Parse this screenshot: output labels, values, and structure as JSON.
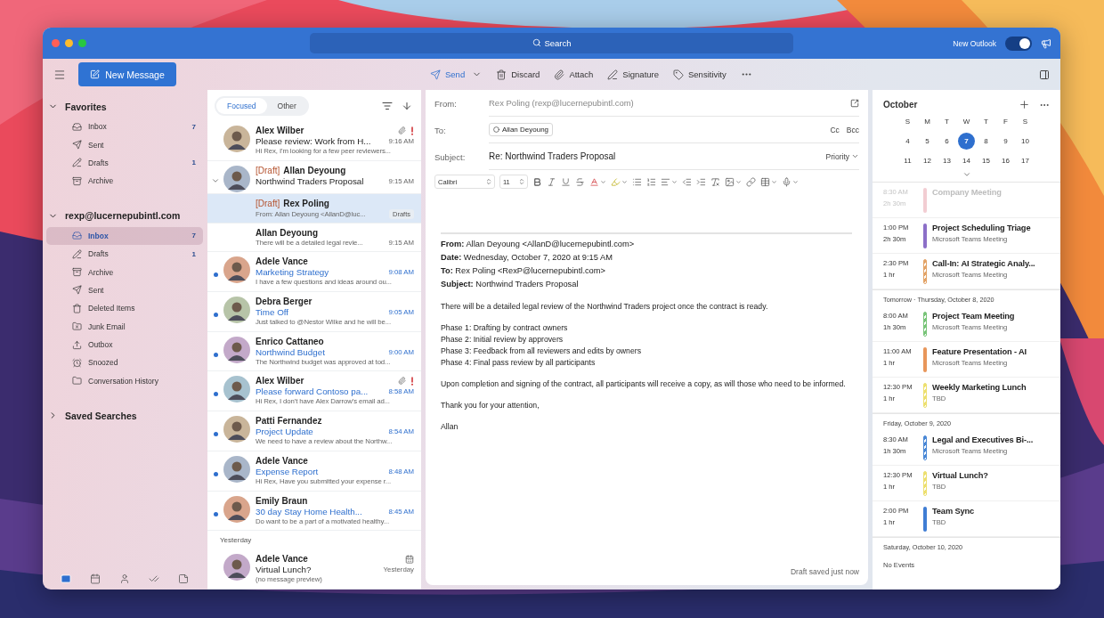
{
  "window": {
    "search": {
      "placeholder": "Search"
    },
    "new_outlook": {
      "label": "New Outlook",
      "on": true
    }
  },
  "toolbar": {
    "new_message": "New Message",
    "actions": [
      {
        "kind": "send",
        "label": "Send"
      },
      {
        "kind": "discard",
        "label": "Discard"
      },
      {
        "kind": "attach",
        "label": "Attach"
      },
      {
        "kind": "signature",
        "label": "Signature"
      },
      {
        "kind": "sensitivity",
        "label": "Sensitivity"
      }
    ]
  },
  "sidebar": {
    "sections": [
      {
        "label": "Favorites",
        "expanded": true,
        "items": [
          {
            "kind": "inbox",
            "label": "Inbox",
            "count": "7",
            "selected": false
          },
          {
            "kind": "sent",
            "label": "Sent",
            "selected": false
          },
          {
            "kind": "drafts",
            "label": "Drafts",
            "count": "1",
            "selected": false
          },
          {
            "kind": "archive",
            "label": "Archive",
            "selected": false
          }
        ]
      },
      {
        "label": "rexp@lucernepubintl.com",
        "expanded": true,
        "items": [
          {
            "kind": "inbox",
            "label": "Inbox",
            "count": "7",
            "selected": true
          },
          {
            "kind": "drafts",
            "label": "Drafts",
            "count": "1",
            "selected": false
          },
          {
            "kind": "archive",
            "label": "Archive",
            "selected": false
          },
          {
            "kind": "sent",
            "label": "Sent",
            "selected": false
          },
          {
            "kind": "deleted",
            "label": "Deleted Items",
            "selected": false
          },
          {
            "kind": "junk",
            "label": "Junk Email",
            "selected": false
          },
          {
            "kind": "outbox",
            "label": "Outbox",
            "selected": false
          },
          {
            "kind": "snoozed",
            "label": "Snoozed",
            "selected": false
          },
          {
            "kind": "folder",
            "label": "Conversation History",
            "selected": false
          }
        ]
      },
      {
        "label": "Saved Searches",
        "expanded": false
      }
    ],
    "bottom_nav": [
      {
        "kind": "mail",
        "selected": true
      },
      {
        "kind": "calendar",
        "selected": false
      },
      {
        "kind": "people",
        "selected": false
      },
      {
        "kind": "tasks",
        "selected": false
      },
      {
        "kind": "notes",
        "selected": false
      }
    ]
  },
  "message_list": {
    "tabs": [
      {
        "label": "Focused",
        "selected": true
      },
      {
        "label": "Other",
        "selected": false
      }
    ],
    "items": [
      {
        "kind": "message",
        "sender": "Alex Wilber",
        "subject": "Please review: Work from H...",
        "time": "9:16 AM",
        "preview": "Hi Rex, I'm looking for a few peer reviewers...",
        "unread": false,
        "selected": false,
        "attachment": true,
        "important": true,
        "meeting": false
      },
      {
        "kind": "message",
        "draft_label": "[Draft]",
        "sender": "Allan Deyoung",
        "subject": "Northwind Traders Proposal",
        "time": "9:15 AM",
        "unread": false,
        "selected": false,
        "attachment": false,
        "important": false,
        "meeting": false,
        "expanded": true,
        "children": [
          {
            "kind": "message",
            "draft_label": "[Draft]",
            "sender": "Rex Poling",
            "preview": "From: Allan Deyoung <AllanD@luc...",
            "folder": "Drafts",
            "unread": false,
            "selected": true,
            "attachment": false,
            "important": false,
            "meeting": false
          },
          {
            "kind": "message",
            "sender": "Allan Deyoung",
            "preview": "There will be a detailed legal revie...",
            "time": "9:15 AM",
            "unread": false,
            "selected": false,
            "attachment": false,
            "important": false,
            "meeting": false
          }
        ]
      },
      {
        "kind": "message",
        "sender": "Adele Vance",
        "subject": "Marketing Strategy",
        "time": "9:08 AM",
        "preview": "I have a few questions and ideas around ou...",
        "unread": true,
        "selected": false,
        "attachment": false,
        "important": false,
        "meeting": false
      },
      {
        "kind": "message",
        "sender": "Debra Berger",
        "subject": "Time Off",
        "time": "9:05 AM",
        "preview": "Just talked to @Nestor Wilke and he will be...",
        "unread": true,
        "selected": false,
        "attachment": false,
        "important": false,
        "meeting": false
      },
      {
        "kind": "message",
        "sender": "Enrico Cattaneo",
        "subject": "Northwind Budget",
        "time": "9:00 AM",
        "preview": "The Northwind budget was approved at tod...",
        "unread": true,
        "selected": false,
        "attachment": false,
        "important": false,
        "meeting": false
      },
      {
        "kind": "message",
        "sender": "Alex Wilber",
        "subject": "Please forward Contoso pa...",
        "time": "8:58 AM",
        "preview": "Hi Rex, I don't have Alex Darrow's email ad...",
        "unread": true,
        "selected": false,
        "attachment": true,
        "important": true,
        "meeting": false
      },
      {
        "kind": "message",
        "sender": "Patti Fernandez",
        "subject": "Project Update",
        "time": "8:54 AM",
        "preview": "We need to have a review about the Northw...",
        "unread": true,
        "selected": false,
        "attachment": false,
        "important": false,
        "meeting": false
      },
      {
        "kind": "message",
        "sender": "Adele Vance",
        "subject": "Expense Report",
        "time": "8:48 AM",
        "preview": "Hi Rex, Have you submitted your expense r...",
        "unread": true,
        "selected": false,
        "attachment": false,
        "important": false,
        "meeting": false
      },
      {
        "kind": "message",
        "sender": "Emily Braun",
        "subject": "30 day Stay Home Health...",
        "time": "8:45 AM",
        "preview": "Do want to be a part of a motivated healthy...",
        "unread": true,
        "selected": false,
        "attachment": false,
        "important": false,
        "meeting": false
      },
      {
        "kind": "heading",
        "label": "Yesterday"
      },
      {
        "kind": "message",
        "sender": "Adele Vance",
        "subject": "Virtual Lunch?",
        "time": "Yesterday",
        "preview": "(no message preview)",
        "unread": false,
        "selected": false,
        "attachment": false,
        "important": false,
        "meeting": true
      }
    ]
  },
  "compose": {
    "from": {
      "label": "From:",
      "value": "Rex Poling (rexp@lucernepubintl.com)"
    },
    "to": {
      "label": "To:",
      "recipients": [
        "Allan Deyoung"
      ],
      "cc": "Cc",
      "bcc": "Bcc"
    },
    "subject": {
      "label": "Subject:",
      "value": "Re: Northwind Traders Proposal",
      "priority": "Priority"
    },
    "format": {
      "font": "Calibri",
      "size": "11"
    },
    "quoted_header": [
      "**From:** Allan Deyoung <AllanD@lucernepubintl.com>",
      "**Date:** Wednesday, October 7, 2020 at 9:15 AM",
      "**To:** Rex Poling <RexP@lucernepubintl.com>",
      "**Subject:** Northwind Traders Proposal"
    ],
    "body": [
      [
        "There will be a detailed legal review of the Northwind Traders project once the contract is ready."
      ],
      [
        "Phase 1: Drafting by contract owners",
        "Phase 2: Initial review by approvers",
        "Phase 3: Feedback from all reviewers and edits by owners",
        "Phase 4: Final pass review by all participants"
      ],
      [
        "Upon completion and signing of the contract, all participants will receive a copy, as will those who need to be informed."
      ],
      [
        "Thank you for your attention,"
      ],
      [
        "Allan"
      ]
    ],
    "status": "Draft saved just now"
  },
  "calendar": {
    "month": "October",
    "weekdays": [
      "S",
      "M",
      "T",
      "W",
      "T",
      "F",
      "S"
    ],
    "weeks": [
      [
        {
          "label": "4",
          "selected": false
        },
        {
          "label": "5",
          "selected": false
        },
        {
          "label": "6",
          "selected": false
        },
        {
          "label": "7",
          "selected": true
        },
        {
          "label": "8",
          "selected": false
        },
        {
          "label": "9",
          "selected": false
        },
        {
          "label": "10",
          "selected": false
        }
      ],
      [
        {
          "label": "11",
          "selected": false
        },
        {
          "label": "12",
          "selected": false
        },
        {
          "label": "13",
          "selected": false
        },
        {
          "label": "14",
          "selected": false
        },
        {
          "label": "15",
          "selected": false
        },
        {
          "label": "16",
          "selected": false
        },
        {
          "label": "17",
          "selected": false
        }
      ]
    ],
    "agenda": [
      {
        "events": [
          {
            "time": "8:30 AM",
            "duration": "2h 30m",
            "title": "Company Meeting",
            "color": "#f2cdd2",
            "striped": false,
            "past": true
          },
          {
            "time": "1:00 PM",
            "duration": "2h 30m",
            "title": "Project Scheduling Triage",
            "subtitle": "Microsoft Teams Meeting",
            "color": "#8c6fc8",
            "striped": false,
            "past": false
          },
          {
            "time": "2:30 PM",
            "duration": "1 hr",
            "title": "Call-In: AI Strategic Analy...",
            "subtitle": "Microsoft Teams Meeting",
            "color": "#e3a468",
            "striped": true,
            "past": false
          }
        ]
      },
      {
        "heading": "Tomorrow · Thursday, October 8, 2020",
        "events": [
          {
            "time": "8:00 AM",
            "duration": "1h 30m",
            "title": "Project Team Meeting",
            "subtitle": "Microsoft Teams Meeting",
            "color": "#78c478",
            "striped": true,
            "past": false
          },
          {
            "time": "11:00 AM",
            "duration": "1 hr",
            "title": "Feature Presentation - AI",
            "subtitle": "Microsoft Teams Meeting",
            "color": "#e8965a",
            "striped": false,
            "past": false
          },
          {
            "time": "12:30 PM",
            "duration": "1 hr",
            "title": "Weekly Marketing Lunch",
            "subtitle": "TBD",
            "color": "#ede070",
            "striped": true,
            "past": false
          }
        ]
      },
      {
        "heading": "Friday, October 9, 2020",
        "events": [
          {
            "time": "8:30 AM",
            "duration": "1h 30m",
            "title": "Legal and Executives Bi-...",
            "subtitle": "Microsoft Teams Meeting",
            "color": "#4a88d6",
            "striped": true,
            "past": false
          },
          {
            "time": "12:30 PM",
            "duration": "1 hr",
            "title": "Virtual Lunch?",
            "subtitle": "TBD",
            "color": "#ede070",
            "striped": true,
            "past": false
          },
          {
            "time": "2:00 PM",
            "duration": "1 hr",
            "title": "Team Sync",
            "subtitle": "TBD",
            "color": "#3f7dd4",
            "striped": false,
            "past": false
          }
        ]
      },
      {
        "heading": "Saturday, October 10, 2020",
        "empty": "No Events"
      }
    ]
  }
}
